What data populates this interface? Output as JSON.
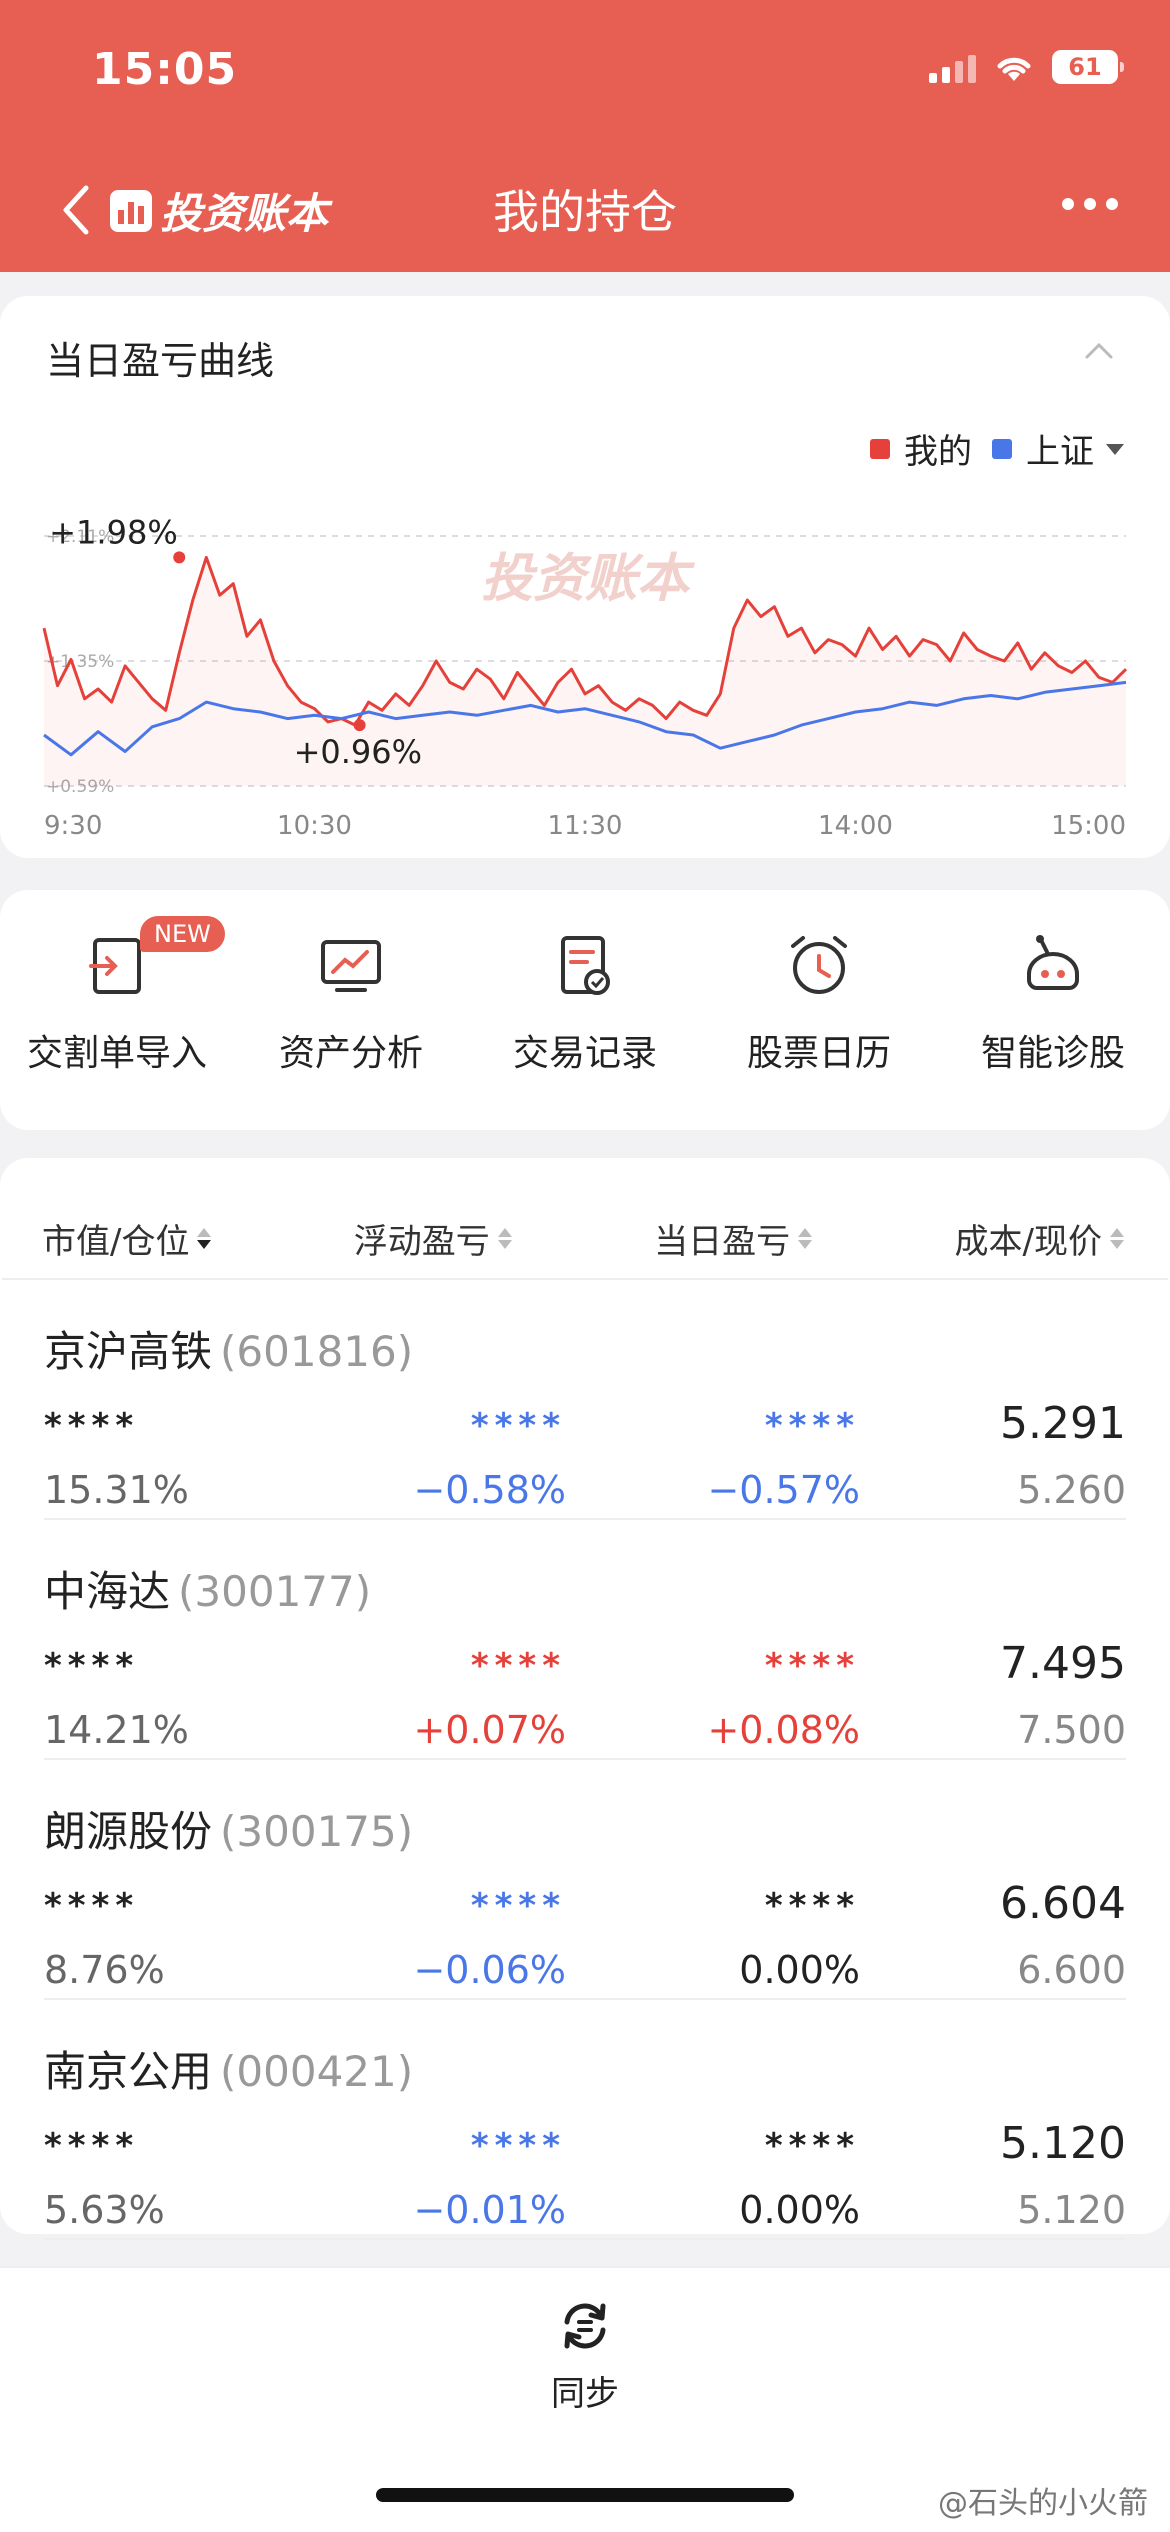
{
  "status": {
    "time": "15:05",
    "battery": "61"
  },
  "nav": {
    "brand": "投资账本",
    "title": "我的持仓"
  },
  "chart_card": {
    "title": "当日盈亏曲线",
    "legend": [
      {
        "name": "我的",
        "color": "#e5413a"
      },
      {
        "name": "上证",
        "color": "#4a77e8"
      }
    ],
    "watermark": "投资账本"
  },
  "chart_data": {
    "type": "line",
    "x_ticks": [
      "9:30",
      "10:30",
      "11:30",
      "14:00",
      "15:00"
    ],
    "y_ticks": [
      "+2.11%",
      "+1.35%",
      "+0.59%"
    ],
    "ylim": [
      0.59,
      2.11
    ],
    "annotations": [
      {
        "label": "+1.98%",
        "x": 30,
        "y": 1.98
      },
      {
        "label": "+0.96%",
        "x": 70,
        "y": 0.96
      }
    ],
    "series": [
      {
        "name": "我的",
        "color": "#e5413a",
        "x": [
          0,
          3,
          6,
          9,
          12,
          15,
          18,
          21,
          24,
          27,
          30,
          33,
          36,
          39,
          42,
          45,
          48,
          51,
          54,
          57,
          60,
          63,
          66,
          69,
          72,
          75,
          78,
          81,
          84,
          87,
          90,
          93,
          96,
          99,
          102,
          105,
          108,
          111,
          114,
          117,
          120,
          123,
          126,
          129,
          132,
          135,
          138,
          141,
          144,
          147,
          150,
          153,
          156,
          159,
          162,
          165,
          168,
          171,
          174,
          177,
          180,
          183,
          186,
          189,
          192,
          195,
          198,
          201,
          204,
          207,
          210,
          213,
          216,
          219,
          222,
          225,
          228,
          231,
          234,
          237,
          240
        ],
        "y": [
          1.55,
          1.2,
          1.36,
          1.12,
          1.18,
          1.1,
          1.32,
          1.22,
          1.12,
          1.05,
          1.4,
          1.72,
          1.98,
          1.75,
          1.82,
          1.5,
          1.6,
          1.35,
          1.2,
          1.1,
          1.06,
          0.98,
          1.0,
          0.96,
          1.1,
          1.05,
          1.15,
          1.08,
          1.2,
          1.35,
          1.22,
          1.18,
          1.3,
          1.24,
          1.12,
          1.28,
          1.18,
          1.08,
          1.22,
          1.3,
          1.15,
          1.2,
          1.1,
          1.05,
          1.12,
          1.08,
          1.0,
          1.1,
          1.05,
          1.02,
          1.15,
          1.55,
          1.72,
          1.62,
          1.68,
          1.5,
          1.55,
          1.4,
          1.48,
          1.45,
          1.38,
          1.55,
          1.42,
          1.5,
          1.38,
          1.48,
          1.45,
          1.35,
          1.52,
          1.42,
          1.38,
          1.35,
          1.46,
          1.3,
          1.4,
          1.32,
          1.28,
          1.35,
          1.25,
          1.22,
          1.3
        ]
      },
      {
        "name": "上证",
        "color": "#4a77e8",
        "x": [
          0,
          6,
          12,
          18,
          24,
          30,
          36,
          42,
          48,
          54,
          60,
          66,
          72,
          78,
          84,
          90,
          96,
          102,
          108,
          114,
          120,
          126,
          132,
          138,
          144,
          150,
          156,
          162,
          168,
          174,
          180,
          186,
          192,
          198,
          204,
          210,
          216,
          222,
          228,
          234,
          240
        ],
        "y": [
          0.9,
          0.78,
          0.92,
          0.8,
          0.95,
          1.0,
          1.1,
          1.06,
          1.04,
          1.0,
          1.02,
          1.0,
          1.04,
          1.0,
          1.02,
          1.04,
          1.02,
          1.05,
          1.08,
          1.04,
          1.06,
          1.02,
          0.98,
          0.92,
          0.9,
          0.82,
          0.86,
          0.9,
          0.96,
          1.0,
          1.04,
          1.06,
          1.1,
          1.08,
          1.12,
          1.14,
          1.12,
          1.16,
          1.18,
          1.2,
          1.22
        ]
      }
    ]
  },
  "tools": [
    {
      "label": "交割单导入",
      "badge": "NEW"
    },
    {
      "label": "资产分析"
    },
    {
      "label": "交易记录"
    },
    {
      "label": "股票日历"
    },
    {
      "label": "智能诊股"
    }
  ],
  "table": {
    "headers": [
      "市值/仓位",
      "浮动盈亏",
      "当日盈亏",
      "成本/现价"
    ],
    "rows": [
      {
        "name": "京沪高铁",
        "code": "(601816)",
        "market": "****",
        "position": "15.31%",
        "float_stars": "****",
        "float_pct": "−0.58%",
        "day_stars": "****",
        "day_pct": "−0.57%",
        "cost": "5.291",
        "price": "5.260"
      },
      {
        "name": "中海达",
        "code": "(300177)",
        "market": "****",
        "position": "14.21%",
        "float_stars": "****",
        "float_pct": "+0.07%",
        "day_stars": "****",
        "day_pct": "+0.08%",
        "cost": "7.495",
        "price": "7.500"
      },
      {
        "name": "朗源股份",
        "code": "(300175)",
        "market": "****",
        "position": "8.76%",
        "float_stars": "****",
        "float_pct": "−0.06%",
        "day_stars": "****",
        "day_pct": "0.00%",
        "cost": "6.604",
        "price": "6.600"
      },
      {
        "name": "南京公用",
        "code": "(000421)",
        "market": "****",
        "position": "5.63%",
        "float_stars": "****",
        "float_pct": "−0.01%",
        "day_stars": "****",
        "day_pct": "0.00%",
        "cost": "5.120",
        "price": "5.120"
      }
    ]
  },
  "bottom": {
    "sync_label": "同步"
  },
  "footer_watermark": "@石头的小火箭"
}
